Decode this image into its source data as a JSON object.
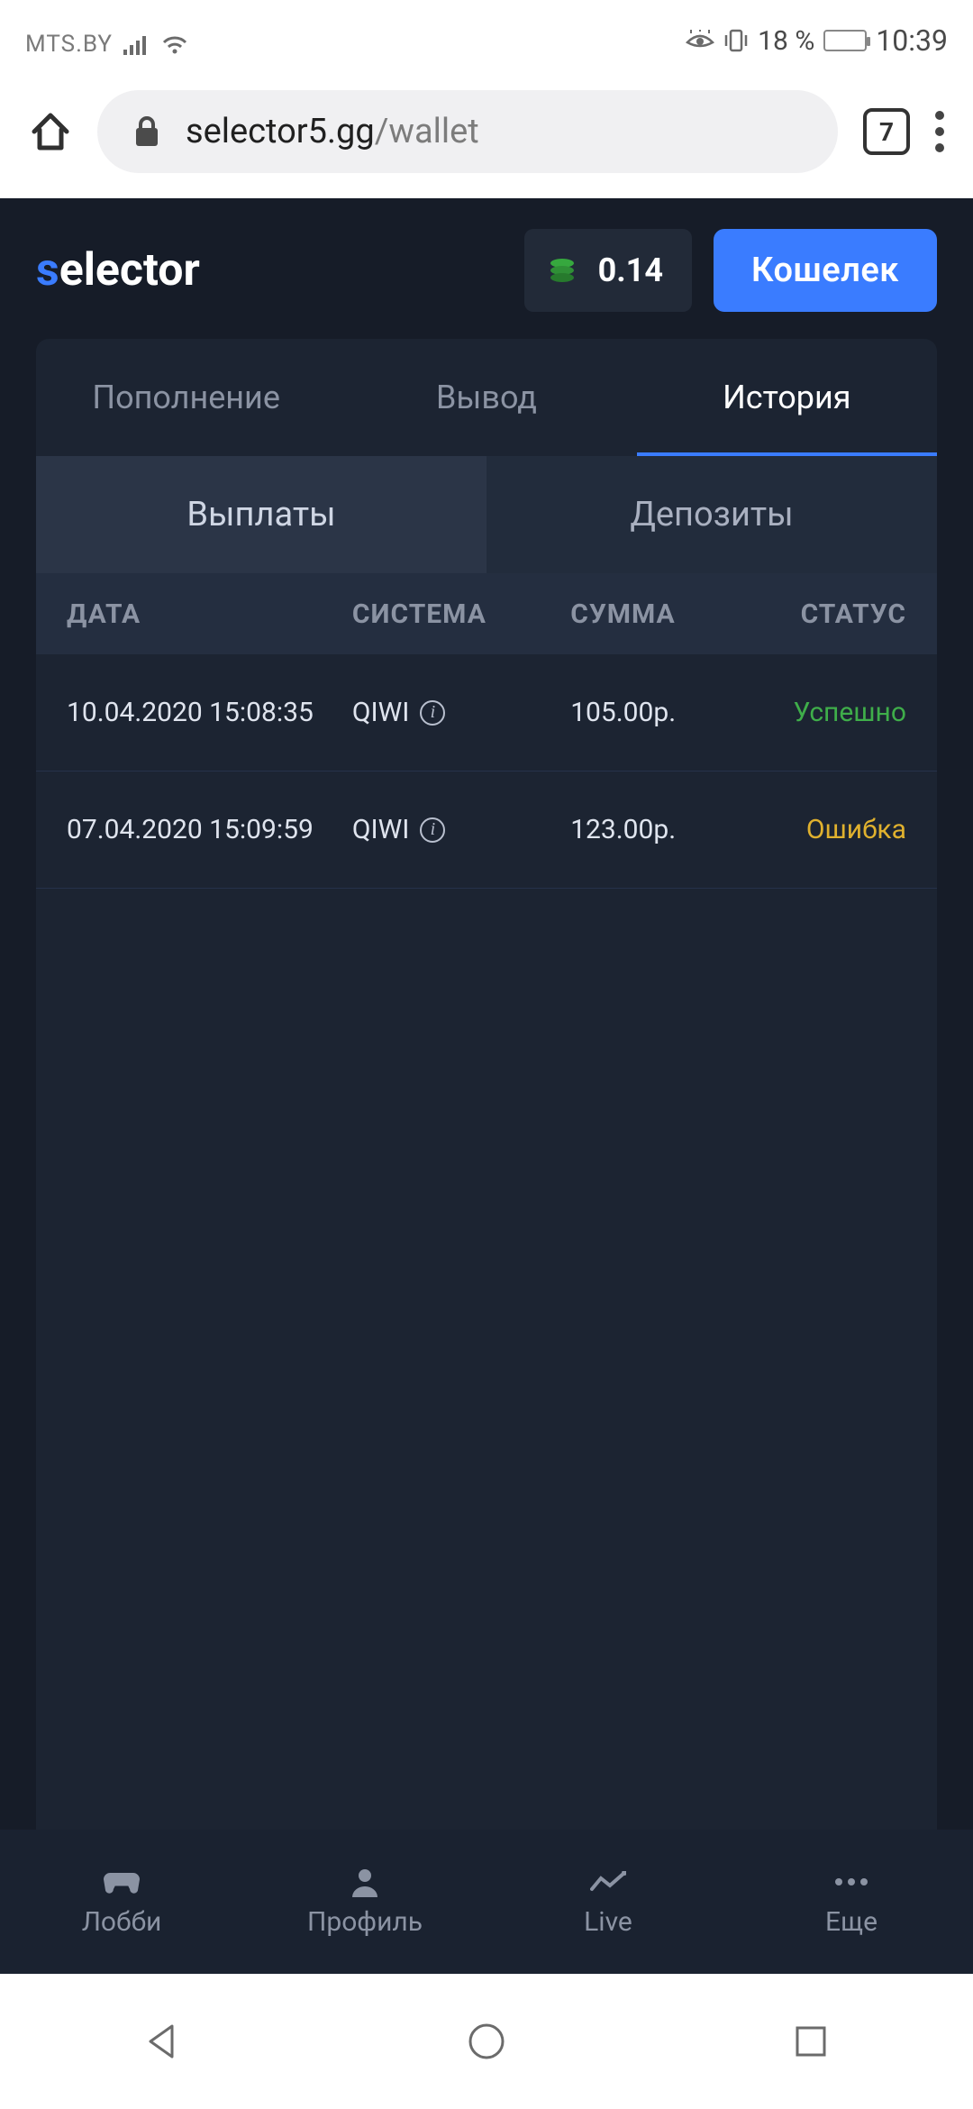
{
  "status_bar": {
    "carrier": "MTS.BY",
    "battery_text": "18 %",
    "time": "10:39"
  },
  "browser": {
    "url_domain": "selector5.gg",
    "url_path": "/wallet",
    "tab_count": "7"
  },
  "site": {
    "logo_s": "s",
    "logo_rest": "elector",
    "balance": "0.14",
    "wallet_button": "Кошелек",
    "tabs_primary": {
      "deposit": "Пополнение",
      "withdraw": "Вывод",
      "history": "История"
    },
    "tabs_secondary": {
      "payouts": "Выплаты",
      "deposits": "Депозиты"
    },
    "table": {
      "head": {
        "date": "ДАТА",
        "system": "СИСТЕМА",
        "sum": "СУММА",
        "status": "СТАТУС"
      },
      "rows": [
        {
          "date": "10.04.2020 15:08:35",
          "system": "QIWI",
          "sum": "105.00р.",
          "status": "Успешно",
          "status_kind": "ok"
        },
        {
          "date": "07.04.2020 15:09:59",
          "system": "QIWI",
          "sum": "123.00р.",
          "status": "Ошибка",
          "status_kind": "err"
        }
      ]
    },
    "bottom_nav": {
      "lobby": "Лобби",
      "profile": "Профиль",
      "live": "Live",
      "more": "Еще"
    }
  }
}
